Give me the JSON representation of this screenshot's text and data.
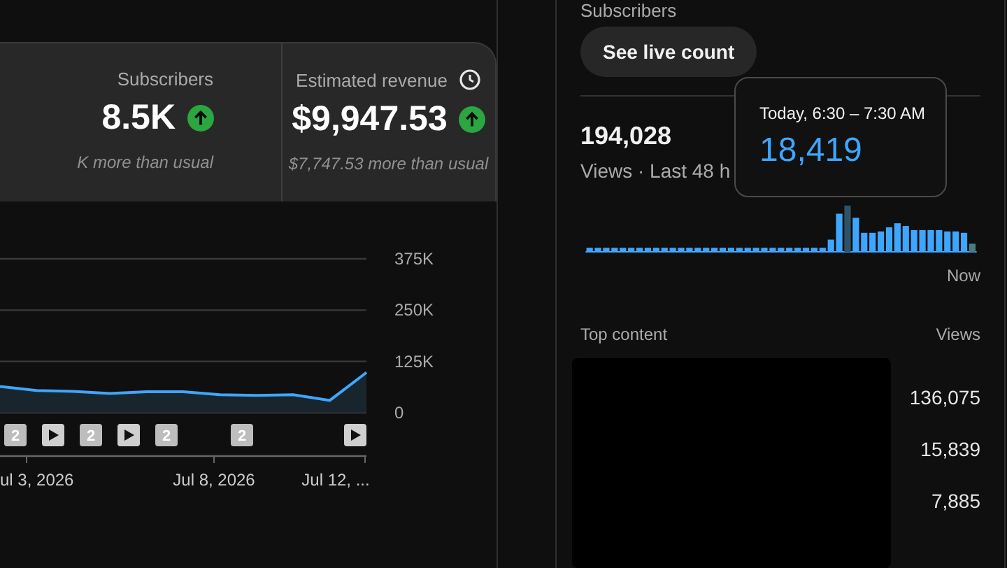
{
  "metrics": [
    {
      "label": "Subscribers",
      "value": "8.5K",
      "rising": true,
      "note": "K more than usual",
      "clock": false
    },
    {
      "label": "Estimated revenue",
      "value": "$9,947.53",
      "rising": true,
      "note": "$7,747.53 more than usual",
      "clock": true
    }
  ],
  "chart": {
    "chart_data": {
      "type": "line",
      "yticks": [
        {
          "value": 0,
          "label": "0"
        },
        {
          "value": 125000,
          "label": "125K"
        },
        {
          "value": 250000,
          "label": "250K"
        },
        {
          "value": 375000,
          "label": "375K"
        }
      ],
      "ylim": [
        0,
        375000
      ],
      "series": [
        {
          "color": "#3ea6ff",
          "values": [
            64000,
            54000,
            52000,
            47000,
            51000,
            51000,
            44000,
            42000,
            44000,
            30000,
            98000
          ]
        }
      ]
    },
    "markers": [
      {
        "kind": "count",
        "label": "2"
      },
      {
        "kind": "video"
      },
      {
        "kind": "count",
        "label": "2"
      },
      {
        "kind": "video"
      },
      {
        "kind": "count",
        "label": "2"
      },
      {
        "kind": "count",
        "label": "2"
      },
      {
        "kind": "video"
      }
    ],
    "x_labels": [
      "ul 3, 2026",
      "Jul 8, 2026",
      "Jul 12, ..."
    ]
  },
  "realtime": {
    "heading": "Subscribers",
    "live_button": "See live count",
    "views": "194,028",
    "views_caption": "Views · Last 48 h",
    "now_label": "Now",
    "tooltip": {
      "title": "Today, 6:30 – 7:30 AM",
      "value": "18,419"
    },
    "top_content": {
      "heading": "Top content",
      "column": "Views",
      "rows": [
        "136,075",
        "15,839",
        "7,885"
      ]
    }
  }
}
